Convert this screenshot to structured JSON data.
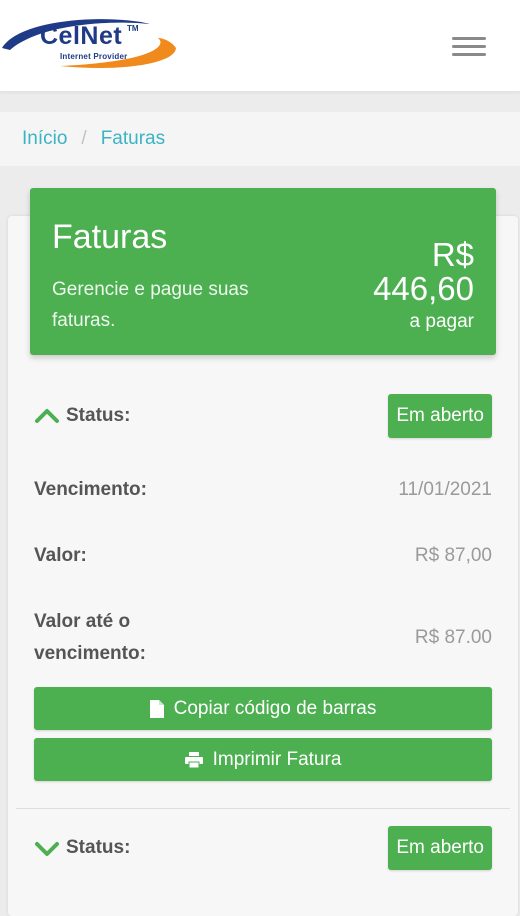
{
  "header": {
    "logo_text": "CelNet",
    "logo_tm": "TM",
    "logo_sub": "Internet Provider",
    "menu_icon": "hamburger-icon"
  },
  "breadcrumb": {
    "items": [
      "Início",
      "Faturas"
    ],
    "separator": "/"
  },
  "banner": {
    "title": "Faturas",
    "description": "Gerencie e pague suas faturas.",
    "currency": "R$",
    "amount": "446,60",
    "amount_suffix": "a pagar",
    "color": "#4caf50"
  },
  "invoices": [
    {
      "status_label": "Status:",
      "status_value": "Em aberto",
      "expanded": true,
      "due_label": "Vencimento:",
      "due_value": "11/01/2021",
      "value_label": "Valor:",
      "value_value": "R$ 87,00",
      "value_until_label": "Valor até o vencimento:",
      "value_until_value": "R$ 87.00",
      "copy_button": "Copiar código de barras",
      "print_button": "Imprimir Fatura"
    },
    {
      "status_label": "Status:",
      "status_value": "Em aberto",
      "expanded": false
    }
  ],
  "colors": {
    "accent": "#4caf50",
    "link": "#3bb3c3",
    "brand_blue": "#1f3a86",
    "brand_orange": "#f08a1c"
  }
}
